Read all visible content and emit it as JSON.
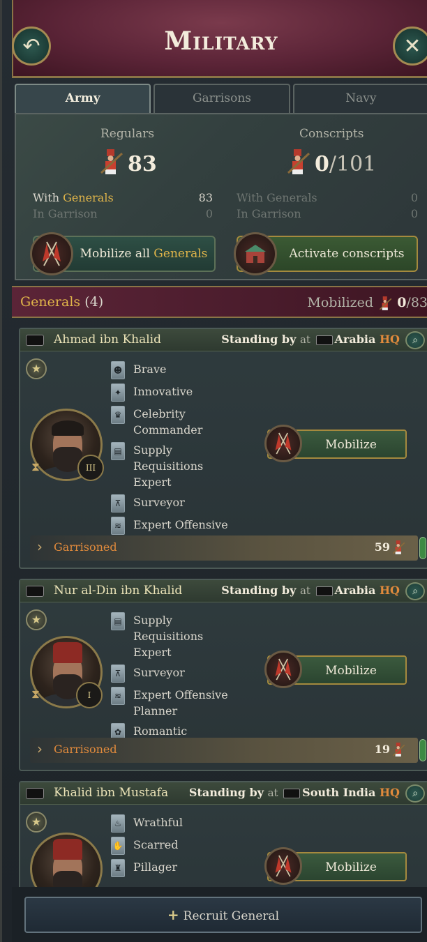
{
  "header": {
    "title": "Military"
  },
  "tabs": [
    {
      "label": "Army",
      "active": true
    },
    {
      "label": "Garrisons",
      "active": false
    },
    {
      "label": "Navy",
      "active": false
    }
  ],
  "army": {
    "regulars": {
      "label": "Regulars",
      "value": "83",
      "with_generals_prefix": "With ",
      "with_generals_word": "Generals",
      "with_generals_value": "83",
      "in_garrison_label": "In Garrison",
      "in_garrison_value": "0"
    },
    "conscripts": {
      "label": "Conscripts",
      "value": "0",
      "max": "/101",
      "with_generals_label": "With Generals",
      "with_generals_value": "0",
      "in_garrison_label": "In Garrison",
      "in_garrison_value": "0"
    },
    "mobilize_all_prefix": "Mobilize all ",
    "mobilize_all_word": "Generals",
    "activate_conscripts": "Activate conscripts"
  },
  "generals_bar": {
    "title": "Generals",
    "count": "4",
    "mobilized_label": "Mobilized",
    "mobilized_value": "0",
    "mobilized_max": "/83"
  },
  "generals": [
    {
      "name": "Ahmad ibn Khalid",
      "status": "Standing by",
      "at": "at",
      "location": "Arabia",
      "hq": "HQ",
      "rank": "III",
      "traits": [
        {
          "label": "Brave",
          "icon": "lion-icon"
        },
        {
          "label": "Innovative",
          "icon": "lightbulb-icon"
        },
        {
          "label": "Celebrity Commander",
          "icon": "crown-icon"
        },
        {
          "label": "Supply Requisitions Expert",
          "icon": "barrel-icon"
        },
        {
          "label": "Surveyor",
          "icon": "theodolite-icon"
        },
        {
          "label": "Expert Offensive Planner",
          "icon": "chevron-rank-icon"
        }
      ],
      "mobilize_label": "Mobilize",
      "garrison_label": "Garrisoned",
      "garrison_count": "59"
    },
    {
      "name": "Nur al-Din ibn Khalid",
      "status": "Standing by",
      "at": "at",
      "location": "Arabia",
      "hq": "HQ",
      "rank": "I",
      "traits": [
        {
          "label": "Supply Requisitions Expert",
          "icon": "barrel-icon"
        },
        {
          "label": "Surveyor",
          "icon": "theodolite-icon"
        },
        {
          "label": "Expert Offensive Planner",
          "icon": "chevron-rank-icon"
        },
        {
          "label": "Romantic",
          "icon": "rose-icon"
        }
      ],
      "mobilize_label": "Mobilize",
      "garrison_label": "Garrisoned",
      "garrison_count": "19"
    },
    {
      "name": "Khalid ibn Mustafa",
      "status": "Standing by",
      "at": "at",
      "location": "South India",
      "hq": "HQ",
      "traits": [
        {
          "label": "Wrathful",
          "icon": "flame-icon"
        },
        {
          "label": "Scarred",
          "icon": "hand-icon"
        },
        {
          "label": "Pillager",
          "icon": "loot-icon"
        }
      ],
      "mobilize_label": "Mobilize"
    }
  ],
  "recruit_label": "Recruit General",
  "colors": {
    "accent_gold": "#e0b54a",
    "hq_orange": "#e08a3c",
    "header_red": "#5b2437"
  }
}
